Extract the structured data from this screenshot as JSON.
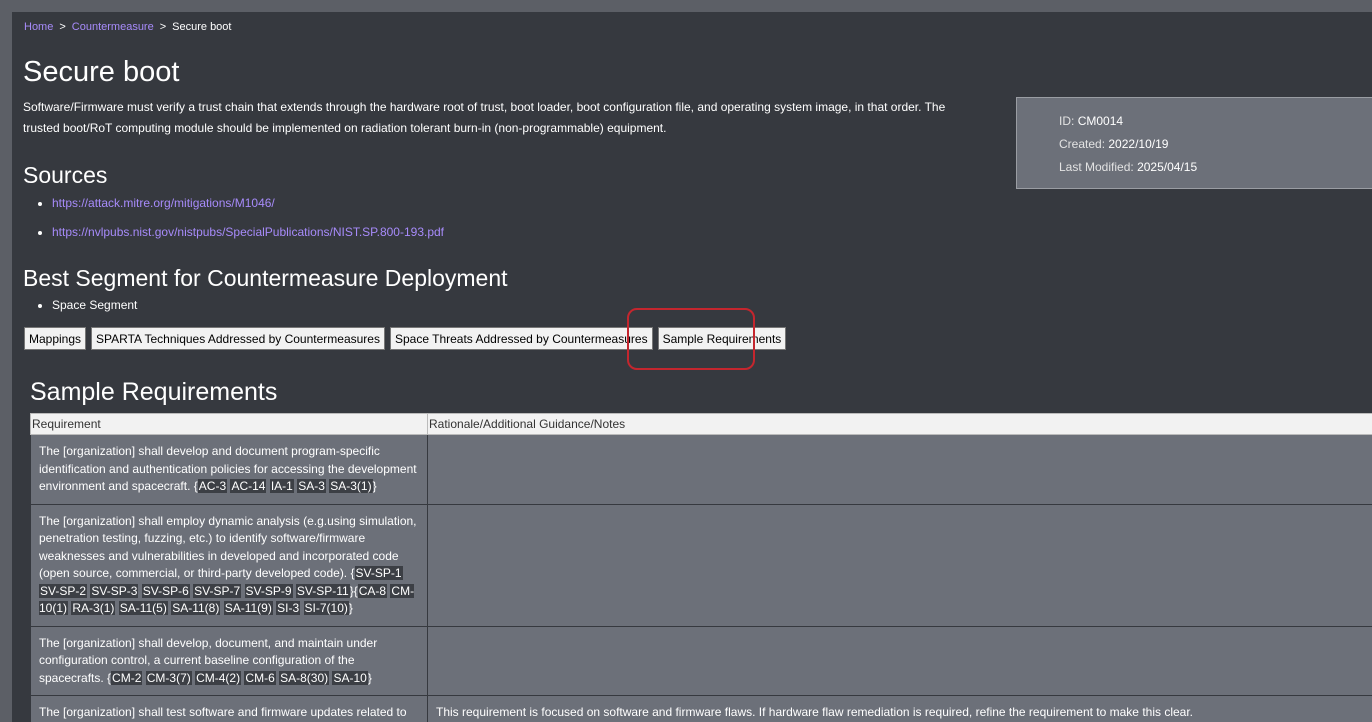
{
  "breadcrumb": {
    "home": "Home",
    "sep": ">",
    "parent": "Countermeasure",
    "current": "Secure boot"
  },
  "title": "Secure boot",
  "description": "Software/Firmware must verify a trust chain that extends through the hardware root of trust, boot loader, boot configuration file, and operating system image, in that order. The trusted boot/RoT computing module should be implemented on radiation tolerant burn-in (non-programmable) equipment.",
  "meta": {
    "id_label": "ID:",
    "id_value": "CM0014",
    "created_label": "Created:",
    "created_value": "2022/10/19",
    "modified_label": "Last Modified:",
    "modified_value": "2025/04/15"
  },
  "sources": {
    "title": "Sources",
    "links": [
      "https://attack.mitre.org/mitigations/M1046/",
      "https://nvlpubs.nist.gov/nistpubs/SpecialPublications/NIST.SP.800-193.pdf"
    ]
  },
  "segment": {
    "title": "Best Segment for Countermeasure Deployment",
    "item": "Space Segment"
  },
  "tabs": [
    "Mappings",
    "SPARTA Techniques Addressed by Countermeasures",
    "Space Threats Addressed by Countermeasures",
    "Sample Requirements"
  ],
  "requirements": {
    "title": "Sample Requirements",
    "headers": [
      "Requirement",
      "Rationale/Additional Guidance/Notes"
    ],
    "rows": [
      {
        "text": "The [organization] shall develop and document program-specific identification and authentication policies for accessing the development environment and spacecraft.",
        "groups": [
          [
            "AC-3",
            "AC-14",
            "IA-1",
            "SA-3",
            "SA-3(1)"
          ]
        ],
        "notes": ""
      },
      {
        "text": "The [organization] shall employ dynamic analysis (e.g.using simulation, penetration testing, fuzzing, etc.) to identify software/firmware weaknesses and vulnerabilities in developed and incorporated code (open source, commercial, or third-party developed code).",
        "groups": [
          [
            "SV-SP-1",
            "SV-SP-2",
            "SV-SP-3",
            "SV-SP-6",
            "SV-SP-7",
            "SV-SP-9",
            "SV-SP-11"
          ],
          [
            "CA-8",
            "CM-10(1)",
            "RA-3(1)",
            "SA-11(5)",
            "SA-11(8)",
            "SA-11(9)",
            "SI-3",
            "SI-7(10)"
          ]
        ],
        "notes": ""
      },
      {
        "text": "The [organization] shall develop, document, and maintain under configuration control, a current baseline configuration of the spacecrafts.",
        "groups": [
          [
            "CM-2",
            "CM-3(7)",
            "CM-4(2)",
            "CM-6",
            "SA-8(30)",
            "SA-10"
          ]
        ],
        "notes": ""
      },
      {
        "text": "The [organization] shall test software and firmware updates related to flaw remediation for effectiveness and potential side effects on mission",
        "groups": [],
        "notes": "This requirement is focused on software and firmware flaws. If hardware flaw remediation is required, refine the requirement to make this clear."
      }
    ]
  }
}
